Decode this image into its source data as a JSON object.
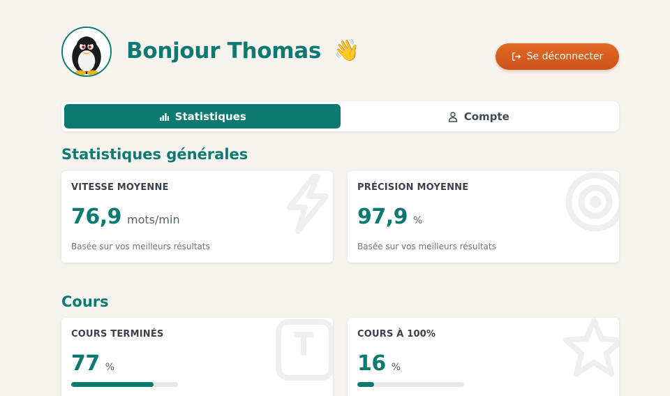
{
  "header": {
    "greeting": "Bonjour Thomas",
    "wave_emoji": "👋",
    "logout_label": "Se déconnecter"
  },
  "tabs": [
    {
      "label": "Statistiques",
      "icon": "bar-chart-icon",
      "active": true
    },
    {
      "label": "Compte",
      "icon": "user-icon",
      "active": false
    }
  ],
  "sections": {
    "general_title": "Statistiques générales",
    "courses_title": "Cours"
  },
  "stats": {
    "speed": {
      "label": "VITESSE MOYENNE",
      "value": "76,9",
      "unit": "mots/min",
      "note": "Basée sur vos meilleurs résultats",
      "icon": "lightning-icon"
    },
    "precision": {
      "label": "PRÉCISION MOYENNE",
      "value": "97,9",
      "unit": "%",
      "note": "Basée sur vos meilleurs résultats",
      "icon": "target-icon"
    }
  },
  "courses": {
    "completed": {
      "label": "COURS TERMINÉS",
      "value": "77",
      "unit": "%",
      "progress": 0.77,
      "icon": "key-t-icon"
    },
    "perfect": {
      "label": "COURS À 100%",
      "value": "16",
      "unit": "%",
      "progress": 0.16,
      "icon": "star-icon"
    }
  },
  "colors": {
    "accent": "#0d7a72",
    "logout": "#d95e1f",
    "background": "#f6f3ef"
  }
}
